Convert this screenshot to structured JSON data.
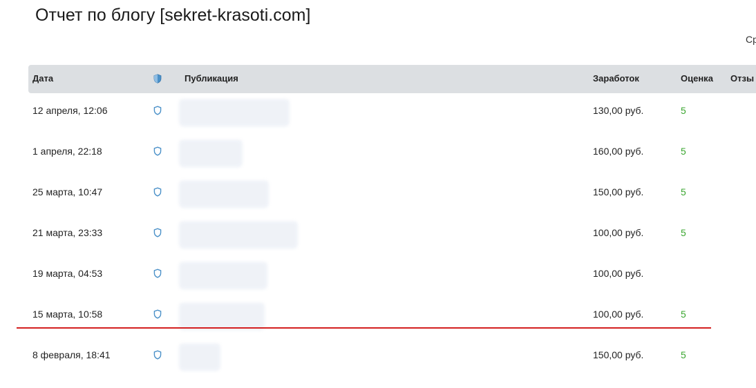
{
  "header": {
    "title": "Отчет по блогу [sekret-krasoti.com]",
    "right_cut_label": "Ср"
  },
  "table": {
    "columns": {
      "date": "Дата",
      "publication": "Публикация",
      "earnings": "Заработок",
      "score": "Оценка",
      "reviews": "Отзы"
    },
    "rows": [
      {
        "date": "12 апреля, 12:06",
        "earnings": "130,00 руб.",
        "score": "5"
      },
      {
        "date": "1 апреля, 22:18",
        "earnings": "160,00 руб.",
        "score": "5"
      },
      {
        "date": "25 марта, 10:47",
        "earnings": "150,00 руб.",
        "score": "5"
      },
      {
        "date": "21 марта, 23:33",
        "earnings": "100,00 руб.",
        "score": "5"
      },
      {
        "date": "19 марта, 04:53",
        "earnings": "100,00 руб.",
        "score": ""
      },
      {
        "date": "15 марта, 10:58",
        "earnings": "100,00 руб.",
        "score": "5"
      },
      {
        "date": "8 февраля, 18:41",
        "earnings": "150,00 руб.",
        "score": "5"
      }
    ]
  },
  "icons": {
    "header_shield": "shield-filled-icon",
    "row_shield": "shield-outline-icon"
  },
  "colors": {
    "header_bg": "#dcdfe2",
    "score_green": "#3aa62f",
    "shield_blue": "#4a90c8",
    "divider_red": "#d31f1f"
  }
}
